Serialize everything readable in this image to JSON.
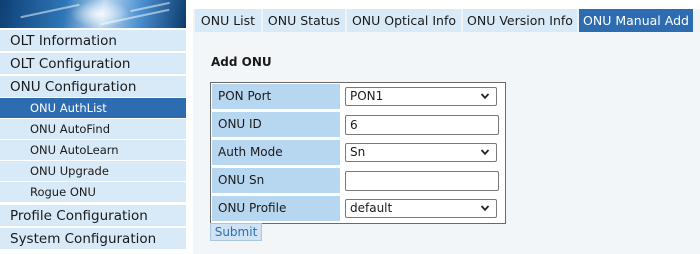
{
  "sidebar": {
    "menu": [
      {
        "label": "OLT Information"
      },
      {
        "label": "OLT Configuration"
      },
      {
        "label": "ONU Configuration"
      }
    ],
    "submenu": [
      {
        "label": "ONU AuthList",
        "active": true
      },
      {
        "label": "ONU AutoFind"
      },
      {
        "label": "ONU AutoLearn"
      },
      {
        "label": "ONU Upgrade"
      },
      {
        "label": "Rogue ONU"
      }
    ],
    "bottom_menu": [
      {
        "label": "Profile Configuration"
      },
      {
        "label": "System Configuration"
      }
    ]
  },
  "tabs": [
    {
      "label": "ONU List"
    },
    {
      "label": "ONU Status"
    },
    {
      "label": "ONU Optical Info"
    },
    {
      "label": "ONU Version Info"
    },
    {
      "label": "ONU Manual Add",
      "active": true
    }
  ],
  "form": {
    "title": "Add ONU",
    "pon_port": {
      "label": "PON Port",
      "value": "PON1"
    },
    "onu_id": {
      "label": "ONU ID",
      "value": "6"
    },
    "auth_mode": {
      "label": "Auth Mode",
      "value": "Sn"
    },
    "onu_sn": {
      "label": "ONU Sn",
      "value": ""
    },
    "onu_profile": {
      "label": "ONU Profile",
      "value": "default"
    },
    "submit_label": "Submit"
  },
  "colors": {
    "accent": "#2d6cb0",
    "menu_bg": "#d8e9f7",
    "label_bg": "#b7d6f0",
    "content_bg": "#f3f6f8"
  },
  "icons": {
    "dropdown": "chevron-down-icon"
  }
}
